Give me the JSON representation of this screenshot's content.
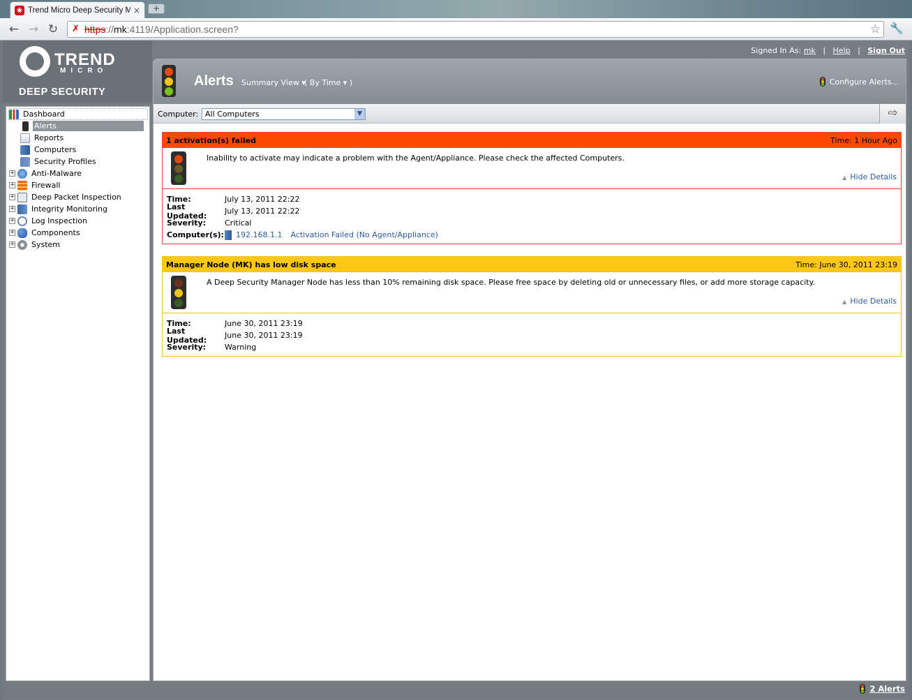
{
  "browser": {
    "tab_title": "Trend Micro Deep Security Ma",
    "tab_close": "×",
    "new_tab": "+",
    "url_scheme": "https",
    "url_sep": "://",
    "url_host": "mk",
    "url_rest": ":4119/Application.screen?"
  },
  "logo": {
    "brand_line1": "TREND",
    "brand_line2": "MICRO",
    "product": "DEEP SECURITY"
  },
  "account": {
    "signed_in_label": "Signed In As:",
    "user": "mk",
    "sep": "|",
    "help": "Help",
    "sign_out": "Sign Out"
  },
  "sidebar": {
    "root": "Dashboard",
    "children": [
      {
        "label": "Alerts",
        "icon": "traffic-light-icon",
        "selected": true
      },
      {
        "label": "Reports",
        "icon": "report-icon"
      },
      {
        "label": "Computers",
        "icon": "computer-icon"
      },
      {
        "label": "Security Profiles",
        "icon": "security-profile-icon"
      }
    ],
    "modules": [
      {
        "label": "Anti-Malware",
        "icon": "anti-malware-icon",
        "expander": "+"
      },
      {
        "label": "Firewall",
        "icon": "firewall-icon",
        "expander": "+"
      },
      {
        "label": "Deep Packet Inspection",
        "icon": "dpi-icon",
        "expander": "+"
      },
      {
        "label": "Integrity Monitoring",
        "icon": "integrity-icon",
        "expander": "+"
      },
      {
        "label": "Log Inspection",
        "icon": "log-inspection-icon",
        "expander": "+"
      },
      {
        "label": "Components",
        "icon": "components-icon",
        "expander": "+"
      },
      {
        "label": "System",
        "icon": "system-gear-icon",
        "expander": "+"
      }
    ]
  },
  "main": {
    "title": "Alerts",
    "view_menu": "Summary View ▾",
    "sort_menu": "( By Time ▾ )",
    "configure": "Configure Alerts...",
    "filter_label": "Computer:",
    "filter_value": "All Computers",
    "go_arrow": "⇨"
  },
  "alerts": [
    {
      "title": "1 activation(s) failed",
      "time_header": "Time: 1 Hour Ago",
      "description": "Inability to activate may indicate a problem with the Agent/Appliance. Please check the affected Computers.",
      "hide_details": "Hide Details",
      "time_label": "Time:",
      "time": "July 13, 2011 22:22",
      "updated_label": "Last Updated:",
      "updated": "July 13, 2011 22:22",
      "severity_label": "Severity:",
      "severity": "Critical",
      "computers_label": "Computer(s):",
      "computer_ip": "192.168.1.1",
      "computer_status": "Activation Failed (No Agent/Appliance)"
    },
    {
      "title": "Manager Node (MK) has low disk space",
      "time_header": "Time: June 30, 2011 23:19",
      "description": "A Deep Security Manager Node has less than 10% remaining disk space. Please free space by deleting old or unnecessary files, or add more storage capacity.",
      "hide_details": "Hide Details",
      "time_label": "Time:",
      "time": "June 30, 2011 23:19",
      "updated_label": "Last Updated:",
      "updated": "June 30, 2011 23:19",
      "severity_label": "Severity:",
      "severity": "Warning"
    }
  ],
  "status": {
    "alert_count": "2 Alerts"
  },
  "colors": {
    "critical": "#fe4900",
    "warning": "#fcc716",
    "link": "#2a5b9e"
  }
}
